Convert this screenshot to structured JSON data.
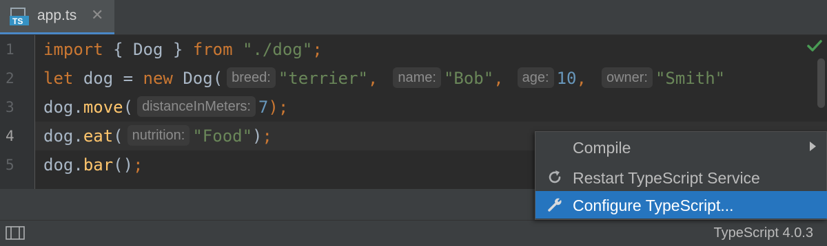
{
  "tab": {
    "icon_label": "TS",
    "filename": "app.ts",
    "close_glyph": "✕"
  },
  "gutter": {
    "lines": [
      "1",
      "2",
      "3",
      "4",
      "5"
    ]
  },
  "code": {
    "line1": {
      "import": "import",
      "brace_open": "{",
      "name": "Dog",
      "brace_close": "}",
      "from": "from",
      "path": "\"./dog\"",
      "semi": ";"
    },
    "line2": {
      "let": "let",
      "var": "dog",
      "eq": "=",
      "new": "new",
      "cls": "Dog(",
      "hint_breed": "breed:",
      "breed": "\"terrier\"",
      "comma1": ",",
      "hint_name": "name:",
      "name": "\"Bob\"",
      "comma2": ",",
      "hint_age": "age:",
      "age": "10",
      "comma3": ",",
      "hint_owner": "owner:",
      "owner": "\"Smith\""
    },
    "line3": {
      "obj": "dog",
      "dot": ".",
      "method": "move",
      "paren": "(",
      "hint": "distanceInMeters:",
      "arg": "7",
      "close": ");"
    },
    "line4": {
      "obj": "dog",
      "dot": ".",
      "method": "eat",
      "paren": "(",
      "hint": "nutrition:",
      "arg": "\"Food\"",
      "close_paren": ")",
      "semi": ";"
    },
    "line5": {
      "obj": "dog",
      "dot": ".",
      "method": "bar",
      "call": "()",
      "semi": ";"
    }
  },
  "context_menu": {
    "items": [
      {
        "label": "Compile",
        "icon": "none",
        "submenu": true
      },
      {
        "label": "Restart TypeScript Service",
        "icon": "refresh-icon"
      },
      {
        "label": "Configure TypeScript...",
        "icon": "wrench-icon",
        "selected": true
      }
    ]
  },
  "status": {
    "typescript_version": "TypeScript 4.0.3"
  },
  "colors": {
    "keyword": "#cc7832",
    "string": "#6a8759",
    "number": "#6897bb",
    "function": "#ffc66d",
    "identifier": "#a9b7c6",
    "selection": "#2675bf",
    "check": "#499c54"
  }
}
